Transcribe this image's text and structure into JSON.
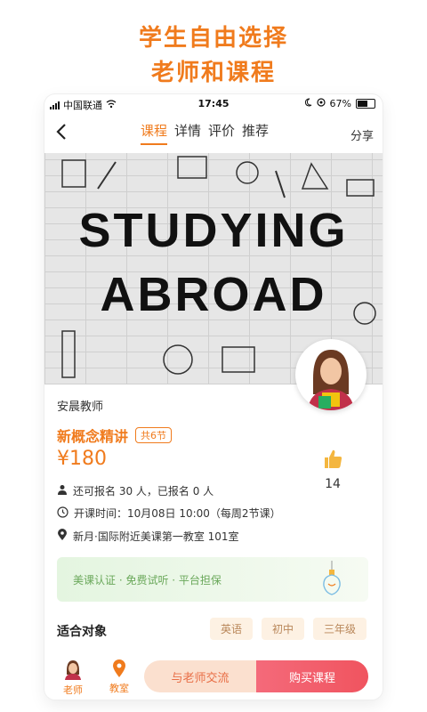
{
  "headline": {
    "line1": "学生自由选择",
    "line2": "老师和课程"
  },
  "status_bar": {
    "carrier": "中国联通",
    "time": "17:45",
    "battery": "67%",
    "battery_level": 0.67
  },
  "nav": {
    "tabs": [
      {
        "label": "课程",
        "active": true
      },
      {
        "label": "详情",
        "active": false
      },
      {
        "label": "评价",
        "active": false
      },
      {
        "label": "推荐",
        "active": false
      }
    ],
    "share_label": "分享"
  },
  "hero": {
    "line1": "STUDYING",
    "line2": "ABROAD"
  },
  "course": {
    "teacher": "安晨教师",
    "title": "新概念精讲",
    "sessions_badge": "共6节",
    "price": "¥180",
    "likes": "14",
    "enrollment": "还可报名 30 人，已报名 0 人",
    "start_time": "开课时间：10月08日 10:00（每周2节课）",
    "location": "新月·国际附近美课第一教室 101室"
  },
  "promo": {
    "text": "美课认证 · 免费试听 · 平台担保"
  },
  "audience": {
    "label": "适合对象",
    "tags": [
      "英语",
      "初中",
      "三年级"
    ]
  },
  "bottom_bar": {
    "teacher_label": "老师",
    "class_label": "教室",
    "chat_button": "与老师交流",
    "buy_button": "购买课程"
  },
  "colors": {
    "accent": "#f07b1d",
    "buy": "#f0545f",
    "promo_green": "#6aa85a"
  }
}
